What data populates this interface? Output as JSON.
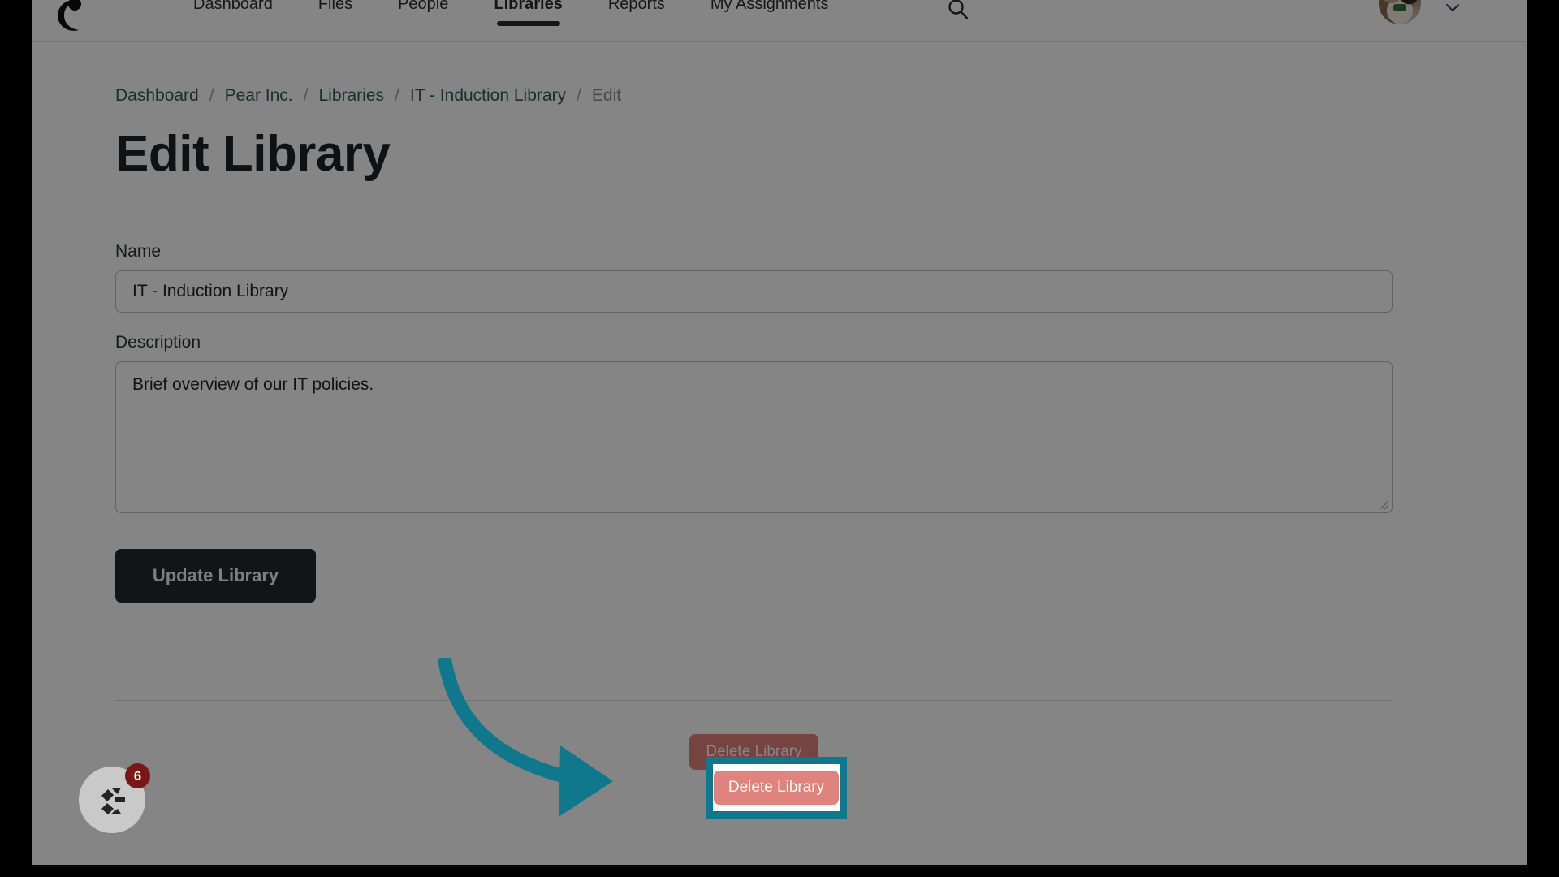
{
  "nav": {
    "logo_icon": "crescent-c-logo-icon",
    "items": [
      {
        "label": "Dashboard",
        "active": false
      },
      {
        "label": "Files",
        "active": false
      },
      {
        "label": "People",
        "active": false
      },
      {
        "label": "Libraries",
        "active": true
      },
      {
        "label": "Reports",
        "active": false
      },
      {
        "label": "My Assignments",
        "active": false
      }
    ],
    "search_icon": "search-icon",
    "avatar_alt": "user-avatar-photo",
    "chevron_icon": "chevron-down-icon"
  },
  "breadcrumb": {
    "items": [
      {
        "label": "Dashboard",
        "current": false
      },
      {
        "label": "Pear Inc.",
        "current": false
      },
      {
        "label": "Libraries",
        "current": false
      },
      {
        "label": "IT - Induction Library",
        "current": false
      },
      {
        "label": "Edit",
        "current": true
      }
    ],
    "separator": "/"
  },
  "page": {
    "title": "Edit Library"
  },
  "form": {
    "name": {
      "label": "Name",
      "value": "IT - Induction Library",
      "placeholder": "Name"
    },
    "description": {
      "label": "Description",
      "value": "Brief overview of our IT policies.",
      "placeholder": "Description"
    },
    "submit_label": "Update Library"
  },
  "danger_zone": {
    "delete_label": "Delete Library"
  },
  "chat_widget": {
    "badge_count": "6",
    "icon": "chat-logo-icon"
  },
  "colors": {
    "accent_teal": "#10788c",
    "breadcrumb_link": "#2c5a61",
    "danger_red": "#e0827e",
    "primary_dark": "#252829",
    "badge_red": "#7a1518"
  }
}
